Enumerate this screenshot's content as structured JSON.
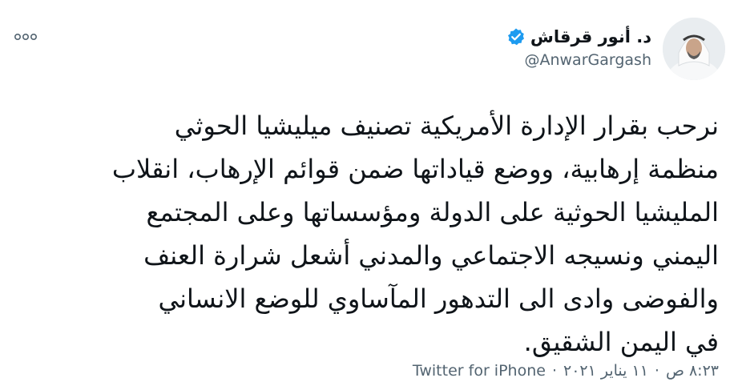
{
  "author": {
    "display_name": "د. أنور قرقاش",
    "handle": "@AnwarGargash",
    "verified_icon": "verified-badge-icon",
    "verified_color": "#1d9bf0",
    "avatar_icon": "profile-photo"
  },
  "more_icon": "more-options-icon",
  "tweet": {
    "lines": [
      "نرحب بقرار الإدارة الأمريكية تصنيف ميليشيا الحوثي",
      "منظمة إرهابية، ووضع قياداتها ضمن قوائم الإرهاب، انقلاب",
      "المليشيا الحوثية على الدولة ومؤسساتها وعلى المجتمع",
      "اليمني ونسيجه الاجتماعي والمدني أشعل شرارة العنف",
      "والفوضى وادى الى التدهور المآساوي للوضع الانساني",
      "في اليمن الشقيق."
    ]
  },
  "meta": {
    "time": "٨:٢٣ ص",
    "separator1": "·",
    "date": "١١ يناير ٢٠٢١",
    "separator2": "·",
    "source": "Twitter for iPhone"
  },
  "colors": {
    "text": "#0f1419",
    "secondary": "#536471"
  }
}
